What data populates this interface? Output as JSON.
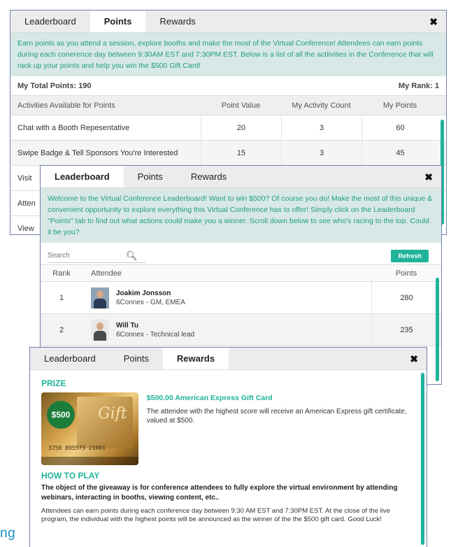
{
  "colors": {
    "accent": "#1fb39a",
    "intro_bg": "#d8e8e6",
    "panel_border": "#6f7fb2"
  },
  "points_panel": {
    "tabs": [
      "Leaderboard",
      "Points",
      "Rewards"
    ],
    "active_tab": "Points",
    "close_label": "✖",
    "intro": "Earn points as you attend a session, explore booths and make the most of the Virtual Conference! Attendees can earn points during each conerence day between 9:30AM EST and 7:30PM EST. Below is a list of all the actiivities in the Conference that will rack up your points and help you win the $500 Gift Card!",
    "total_points": "My Total Points: 190",
    "rank": "My Rank: 1",
    "columns": [
      "Activities Available for Points",
      "Point Value",
      "My Activity Count",
      "My Points"
    ],
    "rows": [
      {
        "activity": "Chat with a Booth Repesentative",
        "value": "20",
        "count": "3",
        "points": "60"
      },
      {
        "activity": "Swipe Badge & Tell Sponsors You're Interested",
        "value": "15",
        "count": "3",
        "points": "45"
      },
      {
        "activity": "Visit",
        "value": "",
        "count": "",
        "points": ""
      },
      {
        "activity": "Atten",
        "value": "",
        "count": "",
        "points": ""
      },
      {
        "activity": "View",
        "value": "",
        "count": "",
        "points": ""
      }
    ]
  },
  "leaderboard_panel": {
    "tabs": [
      "Leaderboard",
      "Points",
      "Rewards"
    ],
    "active_tab": "Leaderboard",
    "close_label": "✖",
    "intro": "Welcome to the Virtual Conference Leaderboard! Want to win $500? Of course you do! Make the most of this unique & convenient opportunity to explore everything this Virtual Conference has to offer! Simply click on the Leaderboard \"Points\" tab to find out what actions could make you a winner. Scroll down below to see who's racing to the top. Could it be you?",
    "search_placeholder": "Search",
    "search_icon": "magnifier",
    "refresh_label": "Refresh",
    "columns": [
      "Rank",
      "Attendee",
      "Points"
    ],
    "rows": [
      {
        "rank": "1",
        "name": "Joakim Jonsson",
        "role": "6Connex - GM, EMEA",
        "points": "280"
      },
      {
        "rank": "2",
        "name": "Will Tu",
        "role": "6Connex - Technical lead",
        "points": "235"
      }
    ]
  },
  "rewards_panel": {
    "tabs": [
      "Leaderboard",
      "Points",
      "Rewards"
    ],
    "active_tab": "Rewards",
    "close_label": "✖",
    "prize_heading": "PRIZE",
    "prize_title": "$500.00 American Express Gift Card",
    "prize_desc": "The attendee with the highest score will receive an American Express gift certificate, valued at $500.",
    "card": {
      "badge": "$500",
      "gift_text": "Gift",
      "number": "3758 895573 21001"
    },
    "howto_heading": "HOW TO PLAY",
    "howto_bold": "The object of the giveaway is for conference attendees to fully explore the virtual environment by attending webinars, interacting in booths, viewing content, etc..",
    "howto_body": "Attendees can earn points during each conference day between 9:30 AM EST and 7:30PM EST.  At the close of the live program, the individual with the highest points will be announced as the winner of the the $500 gift card. Good Luck!"
  },
  "stray_text": "ng"
}
